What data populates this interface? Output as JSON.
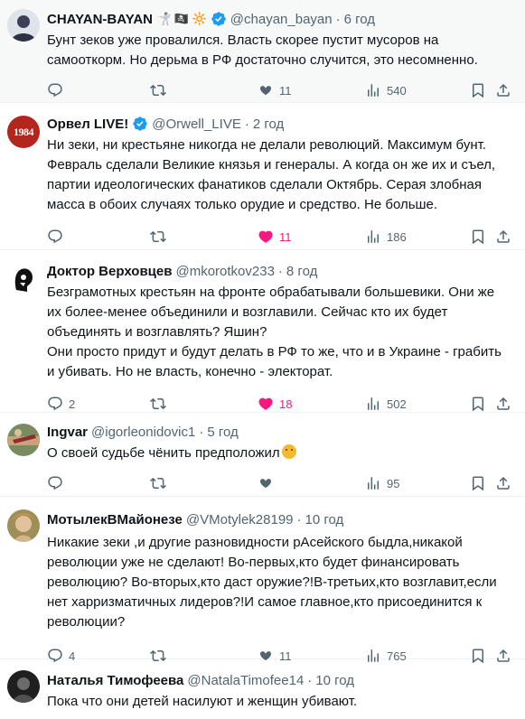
{
  "tweets": [
    {
      "name": "CHAYAN-BAYAN",
      "name_emoji": "🤺 🏴‍☠️ 🔆",
      "handle": "@chayan_bayan",
      "time": "6 год",
      "text": "Бунт зеков уже провалился. Власть скорее пустит мусоров на самооткорм. Но дерьма в РФ достаточно случится, это несомненно.",
      "replies": "",
      "likes": "11",
      "views": "540",
      "liked": false
    },
    {
      "name": "Орвел LIVE!",
      "handle": "@Orwell_LIVE",
      "time": "2 год",
      "avatar_text": "1984",
      "text": "Ни зеки, ни крестьяне никогда не делали революций. Максимум бунт. Февраль сделали Великие князья и генералы. А когда он же их и съел, партии идеологических фанатиков сделали Октябрь. Серая злобная масса в обоих случаях только орудие и средство. Не больше.",
      "replies": "",
      "likes": "11",
      "views": "186",
      "liked": true
    },
    {
      "name": "Доктор Верховцев",
      "handle": "@mkorotkov233",
      "time": "8 год",
      "text1": "Безграмотных крестьян на фронте обрабатывали большевики. Они же их более-менее объединили и возглавили. Сейчас кто их будет объединять и возглавлять? Яшин?",
      "text2": "Они просто придут и будут делать в РФ то же, что и в Украине - грабить и убивать. Но не власть, конечно - электорат.",
      "replies": "2",
      "likes": "18",
      "views": "502",
      "liked": true
    },
    {
      "name": "Ingvar",
      "handle": "@igorleonidovic1",
      "time": "5 год",
      "text": "О своей судьбе чёнить предположил",
      "replies": "",
      "likes": "",
      "views": "95",
      "liked": false
    },
    {
      "name": "МотылекВМайонезе",
      "handle": "@VMotylek28199",
      "time": "10 год",
      "text": "Никакие зеки ,и другие разновидности рАсейского быдла,никакой революции уже не сделают! Во-первых,кто будет финансировать революцию? Во-вторых,кто даст оружие?!В-третьих,кто возглавит,если нет харризматичных лидеров?!И самое главное,кто присоединится к революции?",
      "replies": "4",
      "likes": "11",
      "views": "765",
      "liked": false
    },
    {
      "name": "Наталья Тимофеева",
      "handle": "@NatalaTimofee14",
      "time": "10 год",
      "text": "Пока что они детей насилуют и женщин убивают."
    }
  ],
  "colors": {
    "accent": "#1d9bf0",
    "like": "#f91880",
    "muted": "#536471",
    "text": "#0f1419"
  },
  "icons": [
    "reply-icon",
    "retweet-icon",
    "like-icon",
    "views-icon",
    "bookmark-icon",
    "share-icon",
    "verified-icon"
  ]
}
